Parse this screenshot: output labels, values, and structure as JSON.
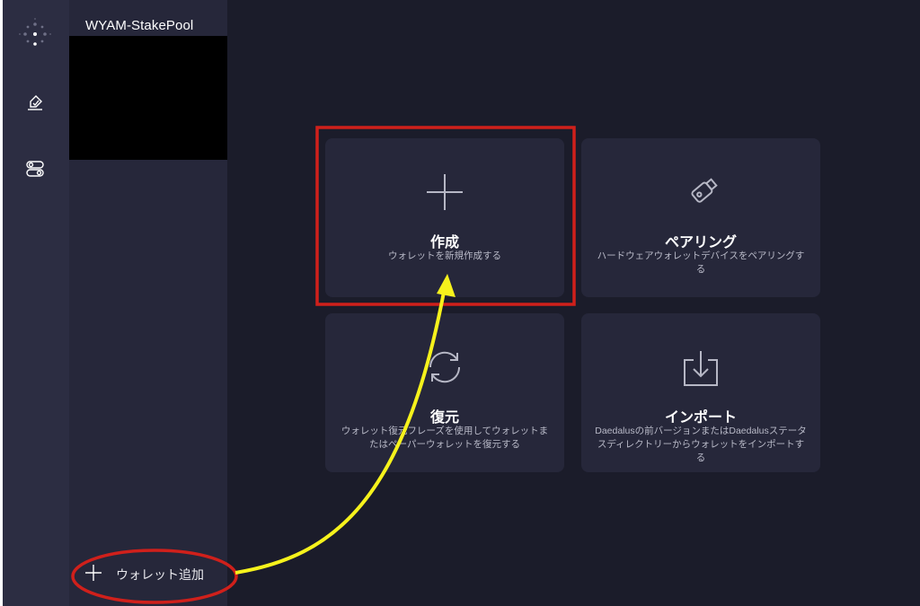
{
  "sidebar": {
    "icons": [
      "loading-dots-icon",
      "wallet-edit-icon",
      "settings-toggle-icon"
    ]
  },
  "wallet_list": {
    "wallet_name": "WYAM-StakePool",
    "add_wallet_label": "ウォレット追加"
  },
  "options": [
    {
      "title": "作成",
      "description": "ウォレットを新規作成する",
      "icon": "plus-icon"
    },
    {
      "title": "ペアリング",
      "description": "ハードウェアウォレットデバイスをペアリングする",
      "icon": "usb-key-icon"
    },
    {
      "title": "復元",
      "description": "ウォレット復元フレーズを使用してウォレットまたはペーパーウォレットを復元する",
      "icon": "restore-icon"
    },
    {
      "title": "インポート",
      "description": "Daedalusの前バージョンまたはDaedalusステータスディレクトリーからウォレットをインポートする",
      "icon": "import-icon"
    }
  ],
  "colors": {
    "background": "#1b1c2a",
    "rail": "#2c2d42",
    "panel": "#26273a",
    "tile": "#26273a",
    "annotation_red": "#d0201b",
    "annotation_yellow": "#f6f21c"
  }
}
